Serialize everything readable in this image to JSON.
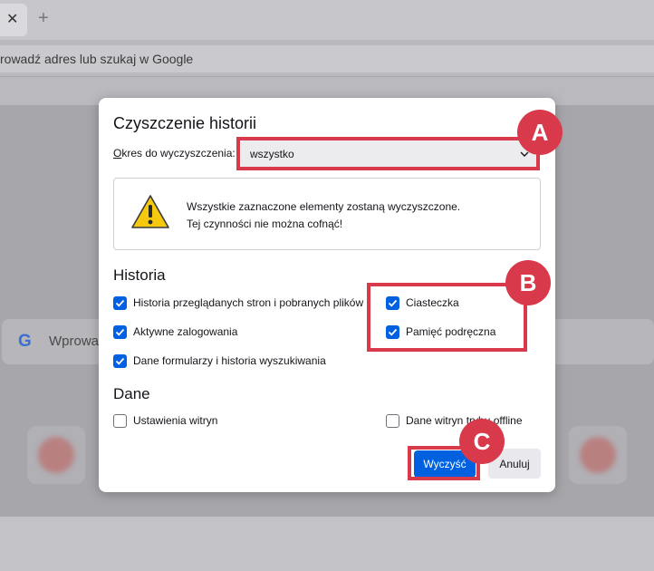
{
  "browser": {
    "tab_close_glyph": "✕",
    "new_tab_glyph": "+",
    "url_placeholder": "rowadź adres lub szukaj w Google",
    "search_logo": "G",
    "search_placeholder": "Wprowa"
  },
  "dialog": {
    "title": "Czyszczenie historii",
    "period_label_accesskey": "O",
    "period_label_rest": "kres do wyczyszczenia:",
    "period_value": "wszystko",
    "warning_line1": "Wszystkie zaznaczone elementy zostaną wyczyszczone.",
    "warning_line2": "Tej czynności nie można cofnąć!",
    "history_heading": "Historia",
    "history_items": [
      {
        "label": "Historia przeglądanych stron i pobranych plików",
        "checked": true
      },
      {
        "label": "Aktywne zalogowania",
        "checked": true
      },
      {
        "label": "Dane formularzy i historia wyszukiwania",
        "checked": true
      },
      {
        "label": "Ciasteczka",
        "checked": true
      },
      {
        "label": "Pamięć podręczna",
        "checked": true
      }
    ],
    "data_heading": "Dane",
    "data_items": [
      {
        "label": "Ustawienia witryn",
        "checked": false
      },
      {
        "label": "Dane witryn trybu offline",
        "checked": false
      }
    ],
    "clear_button": "Wyczyść",
    "cancel_button": "Anuluj"
  },
  "annotations": {
    "a_label": "A",
    "b_label": "B",
    "c_label": "C",
    "color": "#d93a4b"
  },
  "colors": {
    "accent": "#0061e0",
    "annotation": "#d93a4b"
  }
}
